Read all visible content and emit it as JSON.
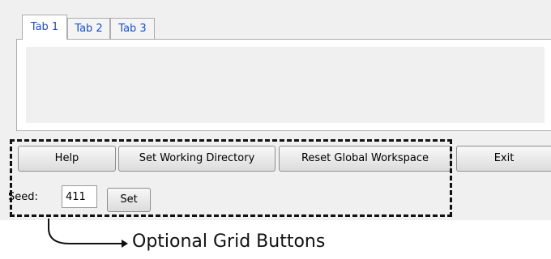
{
  "tabs": [
    {
      "label": "Tab 1",
      "active": true
    },
    {
      "label": "Tab 2",
      "active": false
    },
    {
      "label": "Tab 3",
      "active": false
    }
  ],
  "buttons": {
    "help": "Help",
    "set_working_directory": "Set Working Directory",
    "reset_global_workspace": "Reset Global Workspace",
    "exit": "Exit",
    "set": "Set"
  },
  "seed": {
    "label": "Seed:",
    "value": "411"
  },
  "annotation": {
    "text": "Optional Grid Buttons"
  },
  "colors": {
    "window_background": "#f0f0f0",
    "tab_text": "#1a4fcf",
    "annotation": "#111111"
  }
}
